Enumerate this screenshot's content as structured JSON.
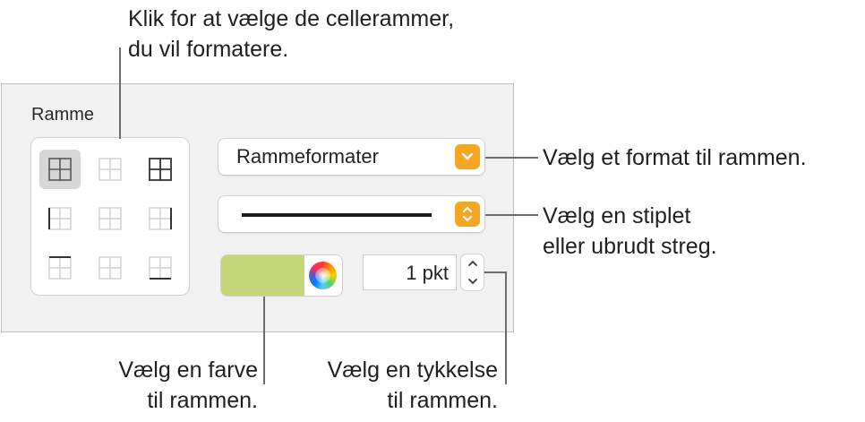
{
  "callouts": {
    "cell_borders": [
      "Klik for at vælge de cellerammer,",
      "du vil formatere."
    ],
    "format": [
      "Vælg et format til rammen."
    ],
    "line_style": [
      "Vælg en stiplet",
      "eller ubrudt streg."
    ],
    "color": [
      "Vælg en farve",
      "til rammen."
    ],
    "thickness": [
      "Vælg en tykkelse",
      "til rammen."
    ]
  },
  "panel": {
    "title": "Ramme",
    "border_format_popup": "Rammeformater",
    "line_style": "solid",
    "color_hex": "#c5d67a",
    "thickness": "1 pkt"
  },
  "border_options": [
    "all-borders",
    "inside-borders",
    "outside-borders",
    "left-border",
    "inside-vertical-borders",
    "right-border",
    "top-border",
    "inside-horizontal-borders",
    "bottom-border"
  ],
  "selected_border_option": "all-borders",
  "colors": {
    "accent": "#f5a623",
    "panel_bg": "#f1f1f1"
  }
}
